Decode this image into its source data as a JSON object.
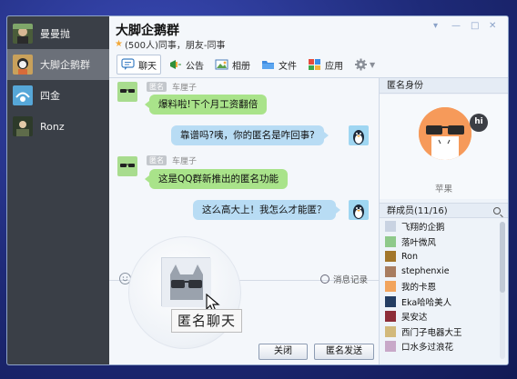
{
  "sidebar": {
    "contacts": [
      {
        "name": "曼曼抛",
        "icon": "user-avatar-icon"
      },
      {
        "name": "大脚企鹅群",
        "icon": "group-avatar-icon"
      },
      {
        "name": "四金",
        "icon": "user-avatar-icon"
      },
      {
        "name": "Ronz",
        "icon": "user-avatar-icon"
      }
    ]
  },
  "header": {
    "title": "大脚企鹅群",
    "subtitle": "(500人)同事，朋友-同事",
    "window_controls": [
      "▾",
      "—",
      "□",
      "✕"
    ]
  },
  "toolbar": {
    "items": [
      {
        "label": "聊天",
        "icon": "chat-icon",
        "active": true
      },
      {
        "label": "公告",
        "icon": "announcement-icon"
      },
      {
        "label": "相册",
        "icon": "photo-album-icon"
      },
      {
        "label": "文件",
        "icon": "folder-icon"
      },
      {
        "label": "应用",
        "icon": "apps-icon"
      },
      {
        "label": "",
        "icon": "gear-icon"
      }
    ]
  },
  "chat": {
    "anon_tag": "匿名",
    "messages": [
      {
        "side": "left",
        "sender": "车厘子",
        "text": "爆料啦!下个月工资翻倍"
      },
      {
        "side": "right",
        "text": "靠谱吗?咦，你的匿名是咋回事?"
      },
      {
        "side": "left",
        "sender": "车厘子",
        "text": "这是QQ群新推出的匿名功能"
      },
      {
        "side": "right",
        "text": "这么高大上！我怎么才能匿？"
      }
    ]
  },
  "input": {
    "history_label": "消息记录",
    "tooltip": "匿名聊天",
    "close_label": "关闭",
    "send_label": "匿名发送"
  },
  "anon_panel": {
    "title": "匿名身份",
    "bubble": "hi",
    "name": "苹果"
  },
  "members": {
    "title": "群成员(11/16)",
    "list": [
      {
        "name": "飞翔的企鹅",
        "color": "#c9d3e2"
      },
      {
        "name": "落叶微风",
        "color": "#8ec98a"
      },
      {
        "name": "Ron",
        "color": "#a2762a"
      },
      {
        "name": "stephenxie",
        "color": "#a87d60"
      },
      {
        "name": "我的卡恩",
        "color": "#f2a45c"
      },
      {
        "name": "Eka哈哈美人",
        "color": "#243d62"
      },
      {
        "name": "吴安达",
        "color": "#8d2d38"
      },
      {
        "name": "西门子电器大王",
        "color": "#d2b97b"
      },
      {
        "name": "口水多过浪花",
        "color": "#c8a8c8"
      }
    ]
  }
}
